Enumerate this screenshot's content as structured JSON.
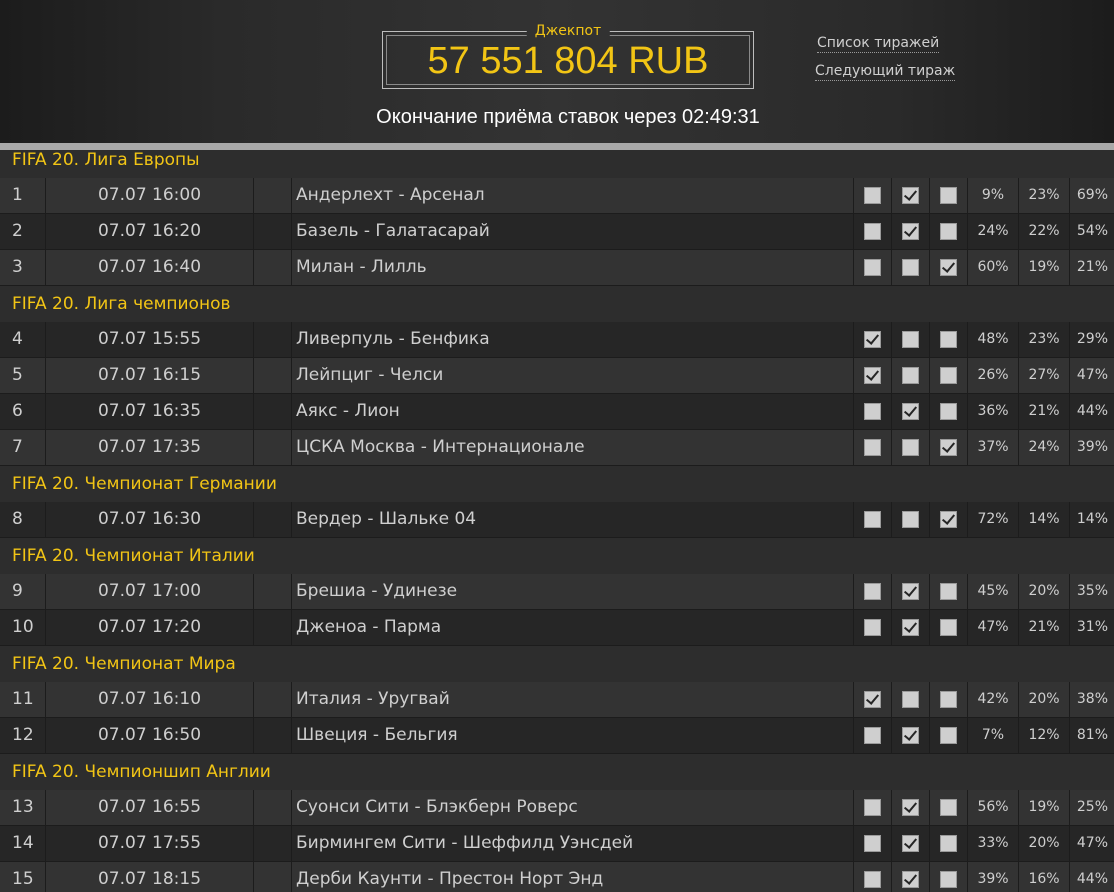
{
  "header": {
    "top_clip_text": "",
    "jackpot_label": "Джекпот",
    "jackpot_amount": "57 551 804 RUB",
    "link_draws_list": "Список тиражей",
    "link_next_draw": "Следующий тираж",
    "deadline_text": "Окончание приёма ставок через 02:49:31"
  },
  "colors": {
    "accent": "#f2c515",
    "background": "#2b2b2b",
    "row_dark": "#262626",
    "row_light": "#333333"
  },
  "groups": [
    {
      "title": "FIFA 20. Лига Европы",
      "matches": [
        {
          "num": "1",
          "time": "07.07 16:00",
          "name": "Андерлехт - Арсенал",
          "checks": [
            false,
            true,
            false
          ],
          "pct": [
            "9%",
            "23%",
            "69%"
          ]
        },
        {
          "num": "2",
          "time": "07.07 16:20",
          "name": "Базель - Галатасарай",
          "checks": [
            false,
            true,
            false
          ],
          "pct": [
            "24%",
            "22%",
            "54%"
          ]
        },
        {
          "num": "3",
          "time": "07.07 16:40",
          "name": "Милан - Лилль",
          "checks": [
            false,
            false,
            true
          ],
          "pct": [
            "60%",
            "19%",
            "21%"
          ]
        }
      ]
    },
    {
      "title": "FIFA 20. Лига чемпионов",
      "matches": [
        {
          "num": "4",
          "time": "07.07 15:55",
          "name": "Ливерпуль - Бенфика",
          "checks": [
            true,
            false,
            false
          ],
          "pct": [
            "48%",
            "23%",
            "29%"
          ]
        },
        {
          "num": "5",
          "time": "07.07 16:15",
          "name": "Лейпциг - Челси",
          "checks": [
            true,
            false,
            false
          ],
          "pct": [
            "26%",
            "27%",
            "47%"
          ]
        },
        {
          "num": "6",
          "time": "07.07 16:35",
          "name": "Аякс - Лион",
          "checks": [
            false,
            true,
            false
          ],
          "pct": [
            "36%",
            "21%",
            "44%"
          ]
        },
        {
          "num": "7",
          "time": "07.07 17:35",
          "name": "ЦСКА Москва - Интернационале",
          "checks": [
            false,
            false,
            true
          ],
          "pct": [
            "37%",
            "24%",
            "39%"
          ]
        }
      ]
    },
    {
      "title": "FIFA 20. Чемпионат Германии",
      "matches": [
        {
          "num": "8",
          "time": "07.07 16:30",
          "name": "Вердер - Шальке 04",
          "checks": [
            false,
            false,
            true
          ],
          "pct": [
            "72%",
            "14%",
            "14%"
          ]
        }
      ]
    },
    {
      "title": "FIFA 20. Чемпионат Италии",
      "matches": [
        {
          "num": "9",
          "time": "07.07 17:00",
          "name": "Брешиа - Удинезе",
          "checks": [
            false,
            true,
            false
          ],
          "pct": [
            "45%",
            "20%",
            "35%"
          ]
        },
        {
          "num": "10",
          "time": "07.07 17:20",
          "name": "Дженоа - Парма",
          "checks": [
            false,
            true,
            false
          ],
          "pct": [
            "47%",
            "21%",
            "31%"
          ]
        }
      ]
    },
    {
      "title": "FIFA 20. Чемпионат Мира",
      "matches": [
        {
          "num": "11",
          "time": "07.07 16:10",
          "name": "Италия - Уругвай",
          "checks": [
            true,
            false,
            false
          ],
          "pct": [
            "42%",
            "20%",
            "38%"
          ]
        },
        {
          "num": "12",
          "time": "07.07 16:50",
          "name": "Швеция - Бельгия",
          "checks": [
            false,
            true,
            false
          ],
          "pct": [
            "7%",
            "12%",
            "81%"
          ]
        }
      ]
    },
    {
      "title": "FIFA 20. Чемпионшип Англии",
      "matches": [
        {
          "num": "13",
          "time": "07.07 16:55",
          "name": "Суонси Сити - Блэкберн Роверс",
          "checks": [
            false,
            true,
            false
          ],
          "pct": [
            "56%",
            "19%",
            "25%"
          ]
        },
        {
          "num": "14",
          "time": "07.07 17:55",
          "name": "Бирмингем Сити - Шеффилд Уэнсдей",
          "checks": [
            false,
            true,
            false
          ],
          "pct": [
            "33%",
            "20%",
            "47%"
          ]
        },
        {
          "num": "15",
          "time": "07.07 18:15",
          "name": "Дерби Каунти - Престон Норт Энд",
          "checks": [
            false,
            true,
            false
          ],
          "pct": [
            "39%",
            "16%",
            "44%"
          ]
        }
      ]
    }
  ]
}
